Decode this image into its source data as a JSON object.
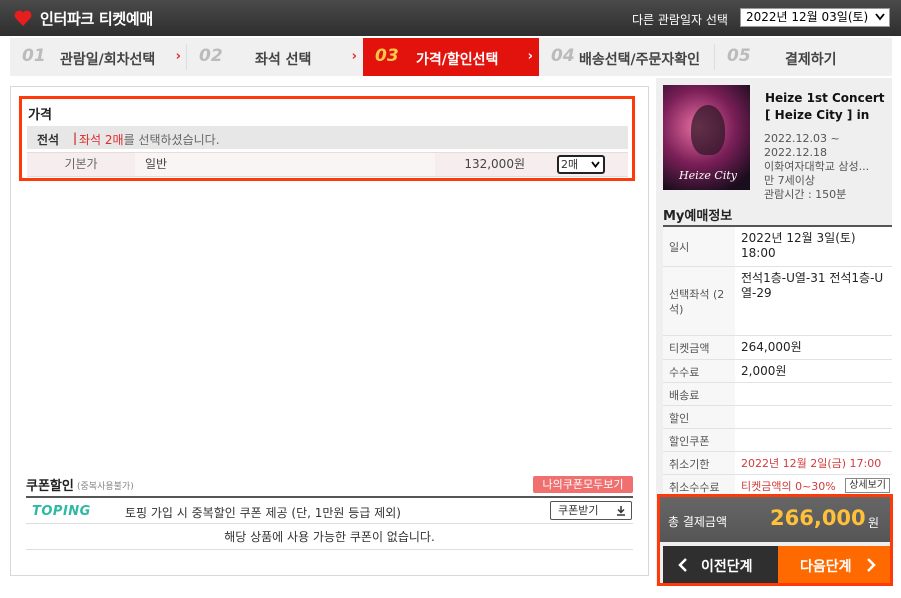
{
  "header": {
    "logo_text": "인터파크 티켓예매",
    "date_label": "다른 관람일자 선택",
    "date_value": "2022년 12월 03일(토)"
  },
  "steps": [
    {
      "num": "01",
      "label": "관람일/회차선택",
      "active": false
    },
    {
      "num": "02",
      "label": "좌석 선택",
      "active": false
    },
    {
      "num": "03",
      "label": "가격/할인선택",
      "active": true
    },
    {
      "num": "04",
      "label": "배송선택/주문자확인",
      "active": false
    },
    {
      "num": "05",
      "label": "결제하기",
      "active": false
    }
  ],
  "price": {
    "title": "가격",
    "grade": "전석",
    "grade_sep": "|",
    "selection_highlight": "좌석 2매",
    "selection_rest": "를 선택하셨습니다.",
    "row_type": "기본가",
    "row_name": "일반",
    "row_price": "132,000원",
    "qty": "2매"
  },
  "coupon": {
    "title": "쿠폰할인",
    "note": "(중복사용불가)",
    "my_coupons_button": "나의쿠폰모두보기",
    "toping_logo": "TOPING",
    "toping_text": "토핑 가입 시 중복할인 쿠폰 제공 (단, 1만원 등급 제외)",
    "get_button": "쿠폰받기",
    "empty_text": "해당 상품에 사용 가능한 쿠폰이 없습니다."
  },
  "show": {
    "poster_text": "Heize City",
    "title": "Heize 1st Concert [ Heize City ] in",
    "period": "2022.12.03 ~ 2022.12.18",
    "venue": "이화여자대학교 삼성...",
    "age": "만 7세이상",
    "runtime": "관람시간 : 150분"
  },
  "my_booking": {
    "title": "My예매정보",
    "rows": [
      {
        "key": "일시",
        "value": "2022년 12월 3일(토) 18:00"
      },
      {
        "key": "선택좌석 (2석)",
        "value": "전석1층-U열-31 전석1층-U열-29"
      },
      {
        "key": "티켓금액",
        "value": "264,000원"
      },
      {
        "key": "수수료",
        "value": "2,000원"
      },
      {
        "key": "배송료",
        "value": ""
      },
      {
        "key": "할인",
        "value": ""
      },
      {
        "key": "할인쿠폰",
        "value": ""
      },
      {
        "key": "취소기한",
        "value": "2022년 12월 2일(금) 17:00"
      },
      {
        "key": "취소수수료",
        "value": "티켓금액의 0~30%"
      }
    ],
    "detail_button": "상세보기"
  },
  "total": {
    "label": "총 결제금액",
    "value": "266,000",
    "unit": "원"
  },
  "nav": {
    "prev": "이전단계",
    "next": "다음단계"
  },
  "colors": {
    "accent_red": "#e2120d",
    "highlight_orange": "#ff3a0a",
    "next_button": "#ff6a00",
    "total_value": "#ffc13a"
  }
}
